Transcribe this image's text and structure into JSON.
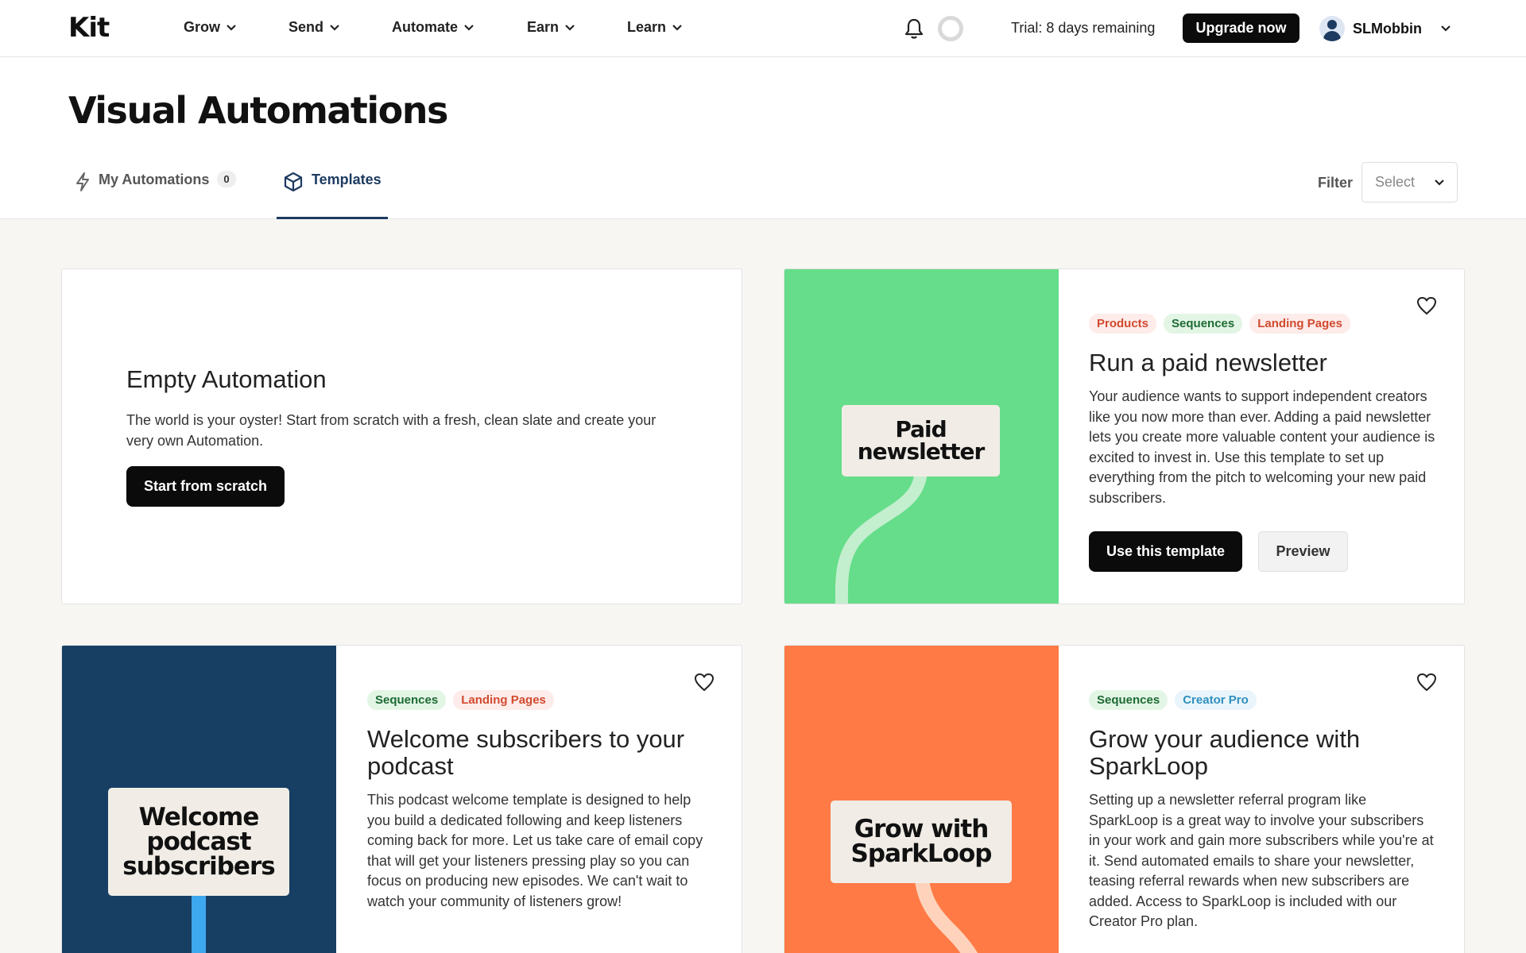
{
  "nav": {
    "logo": "Kit",
    "items": [
      {
        "label": "Grow"
      },
      {
        "label": "Send"
      },
      {
        "label": "Automate"
      },
      {
        "label": "Earn"
      },
      {
        "label": "Learn"
      }
    ],
    "trial_text": "Trial: 8 days remaining",
    "upgrade_label": "Upgrade now",
    "user_name": "SLMobbin"
  },
  "header": {
    "title": "Visual Automations",
    "tabs": [
      {
        "label": "My Automations",
        "count": "0",
        "icon": "lightning-icon"
      },
      {
        "label": "Templates",
        "icon": "cube-icon",
        "active": true
      }
    ],
    "filter_label": "Filter",
    "filter_value": "Select"
  },
  "empty_card": {
    "title": "Empty Automation",
    "description": "The world is your oyster! Start from scratch with a fresh, clean slate and create your very own Automation.",
    "button": "Start from scratch"
  },
  "templates": [
    {
      "art_label": "Paid newsletter",
      "art_color": "#66dd8a",
      "tags": [
        {
          "label": "Products",
          "color": "red"
        },
        {
          "label": "Sequences",
          "color": "green"
        },
        {
          "label": "Landing Pages",
          "color": "red"
        }
      ],
      "title": "Run a paid newsletter",
      "description": "Your audience wants to support independent creators like you now more than ever. Adding a paid newsletter lets you create more valuable content your audience is excited to invest in. Use this template to set up everything from the pitch to welcoming your new paid subscribers.",
      "use_button": "Use this template",
      "preview_button": "Preview"
    },
    {
      "art_label": "Welcome podcast subscribers",
      "art_color": "#163f63",
      "tags": [
        {
          "label": "Sequences",
          "color": "green"
        },
        {
          "label": "Landing Pages",
          "color": "red"
        }
      ],
      "title": "Welcome subscribers to your podcast",
      "description": "This podcast welcome template is designed to help you build a dedicated following and keep listeners coming back for more. Let us take care of email copy that will get your listeners pressing play so you can focus on producing new episodes. We can't wait to watch your community of listeners grow!"
    },
    {
      "art_label": "Grow with SparkLoop",
      "art_color": "#ff7a45",
      "tags": [
        {
          "label": "Sequences",
          "color": "green"
        },
        {
          "label": "Creator Pro",
          "color": "blue"
        }
      ],
      "title": "Grow your audience with SparkLoop",
      "description": "Setting up a newsletter referral program like SparkLoop is a great way to involve your subscribers in your work and gain more subscribers while you're at it. Send automated emails to share your newsletter, teasing referral rewards when new subscribers are added. Access to SparkLoop is included with our Creator Pro plan."
    }
  ]
}
